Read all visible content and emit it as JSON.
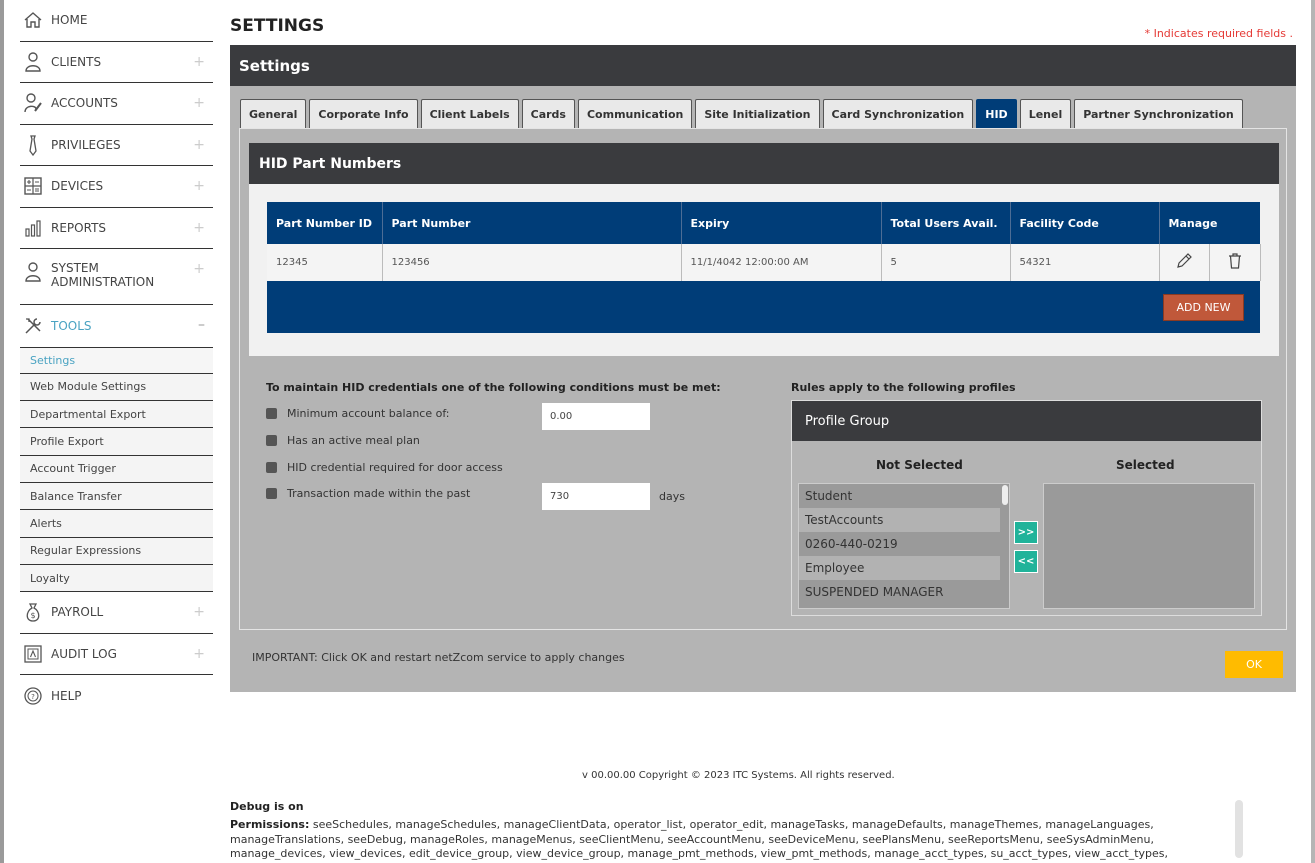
{
  "sidebar": {
    "items": [
      {
        "label": "HOME",
        "icon": "home-icon",
        "plus": ""
      },
      {
        "label": "CLIENTS",
        "icon": "user-icon",
        "plus": "+"
      },
      {
        "label": "ACCOUNTS",
        "icon": "user-edit-icon",
        "plus": "+"
      },
      {
        "label": "PRIVILEGES",
        "icon": "tie-icon",
        "plus": "+"
      },
      {
        "label": "DEVICES",
        "icon": "calculator-icon",
        "plus": "+"
      },
      {
        "label": "REPORTS",
        "icon": "chart-icon",
        "plus": "+"
      },
      {
        "label": "SYSTEM ADMINISTRATION",
        "icon": "admin-user-icon",
        "plus": "+"
      },
      {
        "label": "TOOLS",
        "icon": "tools-icon",
        "plus": "–"
      }
    ],
    "tools_sub": [
      "Settings",
      "Web Module Settings",
      "Departmental Export",
      "Profile Export",
      "Account Trigger",
      "Balance Transfer",
      "Alerts",
      "Regular Expressions",
      "Loyalty"
    ],
    "bottom_items": [
      {
        "label": "PAYROLL",
        "icon": "money-bag-icon",
        "plus": "+"
      },
      {
        "label": "AUDIT LOG",
        "icon": "audit-icon",
        "plus": "+"
      },
      {
        "label": "HELP",
        "icon": "help-icon",
        "plus": ""
      }
    ]
  },
  "page": {
    "title": "SETTINGS",
    "required_note": "* Indicates required fields .",
    "panel_title": "Settings"
  },
  "tabs": [
    "General",
    "Corporate Info",
    "Client Labels",
    "Cards",
    "Communication",
    "Site Initialization",
    "Card Synchronization",
    "HID",
    "Lenel",
    "Partner Synchronization"
  ],
  "hid": {
    "title": "HID Part Numbers",
    "columns": [
      "Part Number ID",
      "Part Number",
      "Expiry",
      "Total Users Avail.",
      "Facility Code",
      "Manage"
    ],
    "row": {
      "id": "12345",
      "part_number": "123456",
      "expiry": "11/1/4042 12:00:00 AM",
      "total_users": "5",
      "facility_code": "54321"
    },
    "add_new": "ADD NEW"
  },
  "conditions": {
    "title": "To maintain HID credentials one of the following conditions must be met:",
    "min_balance_label": "Minimum account balance of:",
    "min_balance_value": "0.00",
    "meal_plan_label": "Has an active meal plan",
    "door_access_label": "HID credential required for door access",
    "transaction_label": "Transaction made within the past",
    "transaction_value": "730",
    "days": "days"
  },
  "profiles": {
    "title": "Rules apply to the following profiles",
    "group_title": "Profile Group",
    "not_selected_label": "Not Selected",
    "selected_label": "Selected",
    "not_selected": [
      "Student",
      "TestAccounts",
      "0260-440-0219",
      "Employee",
      "SUSPENDED MANAGER"
    ],
    "move_right": ">>",
    "move_left": "<<"
  },
  "footer": {
    "important": "IMPORTANT: Click OK and restart netZcom service to apply changes",
    "ok": "OK",
    "copyright": "v 00.00.00 Copyright © 2023 ITC Systems. All rights reserved.",
    "debug": "Debug is on",
    "permissions_label": "Permissions:",
    "permissions_text": "seeSchedules, manageSchedules, manageClientData, operator_list, operator_edit, manageTasks, manageDefaults, manageThemes, manageLanguages, manageTranslations, seeDebug, manageRoles, manageMenus, seeClientMenu, seeAccountMenu, seeDeviceMenu, seePlansMenu, seeReportsMenu, seeSysAdminMenu, manage_devices, view_devices, edit_device_group, view_device_group, manage_pmt_methods, view_pmt_methods, manage_acct_types, su_acct_types, view_acct_types, manage_meal_plans, edit_meal_plans,"
  },
  "colors": {
    "accent": "#4aa3c2",
    "header_dark": "#3a3b3e",
    "table_blue": "#003d78",
    "add_btn": "#c0583a",
    "ok_btn": "#ffbb00",
    "move_btn": "#20b39a"
  }
}
